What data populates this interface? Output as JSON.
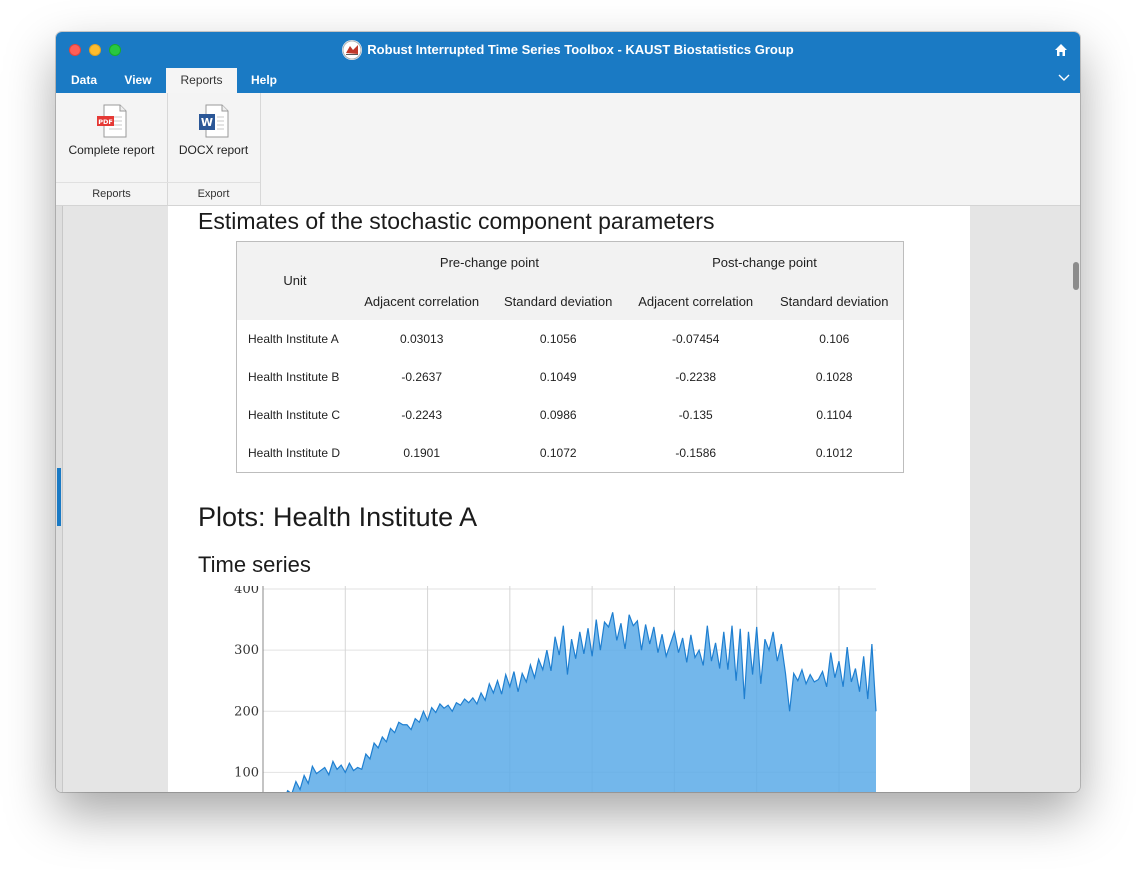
{
  "window": {
    "title": "Robust Interrupted Time Series Toolbox - KAUST Biostatistics Group"
  },
  "menu": {
    "items": [
      "Data",
      "View",
      "Reports",
      "Help"
    ],
    "active": "Reports"
  },
  "ribbon": {
    "groups": [
      {
        "label": "Reports",
        "buttons": [
          {
            "label": "Complete report",
            "icon": "pdf-file-icon"
          }
        ]
      },
      {
        "label": "Export",
        "buttons": [
          {
            "label": "DOCX report",
            "icon": "word-file-icon"
          }
        ]
      }
    ]
  },
  "report": {
    "section_title": "Estimates of the stochastic component parameters",
    "table": {
      "unit_header": "Unit",
      "group_headers": [
        "Pre-change point",
        "Post-change point"
      ],
      "sub_headers": [
        "Adjacent correlation",
        "Standard deviation",
        "Adjacent correlation",
        "Standard deviation"
      ],
      "rows": [
        [
          "Health Institute A",
          "0.03013",
          "0.1056",
          "-0.07454",
          "0.106"
        ],
        [
          "Health Institute B",
          "-0.2637",
          "0.1049",
          "-0.2238",
          "0.1028"
        ],
        [
          "Health Institute C",
          "-0.2243",
          "0.0986",
          "-0.135",
          "0.1104"
        ],
        [
          "Health Institute D",
          "0.1901",
          "0.1072",
          "-0.1586",
          "0.1012"
        ]
      ]
    },
    "plots_title": "Plots: Health Institute A",
    "plots_subtitle": "Time series"
  },
  "chart_data": {
    "type": "area",
    "title": "",
    "xlabel": "",
    "ylabel": "",
    "ylim": [
      45,
      405
    ],
    "yticks": [
      100,
      200,
      300,
      400
    ],
    "grid": true,
    "x": [
      0,
      1,
      2,
      3,
      4,
      5,
      6,
      7,
      8,
      9,
      10,
      11,
      12,
      13,
      14,
      15,
      16,
      17,
      18,
      19,
      20,
      21,
      22,
      23,
      24,
      25,
      26,
      27,
      28,
      29,
      30,
      31,
      32,
      33,
      34,
      35,
      36,
      37,
      38,
      39,
      40,
      41,
      42,
      43,
      44,
      45,
      46,
      47,
      48,
      49,
      50,
      51,
      52,
      53,
      54,
      55,
      56,
      57,
      58,
      59,
      60,
      61,
      62,
      63,
      64,
      65,
      66,
      67,
      68,
      69,
      70,
      71,
      72,
      73,
      74,
      75,
      76,
      77,
      78,
      79,
      80,
      81,
      82,
      83,
      84,
      85,
      86,
      87,
      88,
      89,
      90,
      91,
      92,
      93,
      94,
      95,
      96,
      97,
      98,
      99,
      100,
      101,
      102,
      103,
      104,
      105,
      106,
      107,
      108,
      109,
      110,
      111,
      112,
      113,
      114,
      115,
      116,
      117,
      118,
      119,
      120,
      121,
      122,
      123,
      124,
      125,
      126,
      127,
      128,
      129,
      130,
      131,
      132,
      133,
      134,
      135,
      136,
      137,
      138,
      139,
      140,
      141,
      142,
      143,
      144,
      145,
      146,
      147,
      148,
      149
    ],
    "series": [
      {
        "color": "#5aaae8",
        "line_color": "#1f7fd0",
        "values": [
          40,
          45,
          58,
          48,
          62,
          55,
          70,
          65,
          85,
          72,
          95,
          82,
          110,
          98,
          103,
          108,
          96,
          118,
          105,
          112,
          100,
          115,
          103,
          108,
          105,
          130,
          122,
          148,
          140,
          158,
          150,
          172,
          165,
          182,
          178,
          178,
          170,
          188,
          182,
          200,
          185,
          206,
          198,
          212,
          205,
          210,
          200,
          214,
          210,
          220,
          214,
          222,
          212,
          230,
          218,
          245,
          230,
          250,
          228,
          260,
          240,
          265,
          232,
          262,
          248,
          276,
          255,
          285,
          268,
          300,
          266,
          322,
          292,
          340,
          260,
          318,
          286,
          330,
          294,
          336,
          290,
          350,
          300,
          346,
          338,
          362,
          316,
          344,
          302,
          358,
          340,
          348,
          300,
          342,
          310,
          338,
          296,
          326,
          290,
          310,
          330,
          296,
          320,
          280,
          325,
          288,
          300,
          275,
          340,
          282,
          312,
          270,
          330,
          268,
          340,
          250,
          335,
          220,
          330,
          260,
          338,
          245,
          318,
          300,
          330,
          282,
          310,
          262,
          200,
          262,
          250,
          268,
          245,
          260,
          248,
          252,
          265,
          240,
          296,
          255,
          282,
          240,
          305,
          248,
          270,
          232,
          290,
          220,
          310,
          200
        ]
      }
    ]
  }
}
